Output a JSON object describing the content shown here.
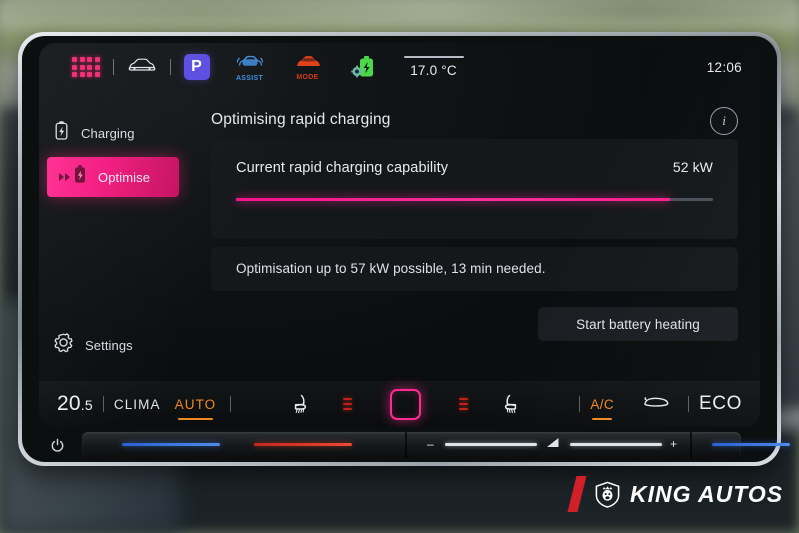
{
  "statusbar": {
    "apps_icon": "grid-apps-icon",
    "car_icon": "car-front-icon",
    "park_badge": "P",
    "assist_label": "ASSIST",
    "mode_label": "MODE",
    "battery_settings_icon": "battery-gear-icon",
    "temperature": "17.0 °C",
    "clock": "12:06"
  },
  "sidebar": {
    "items": [
      {
        "label": "Charging",
        "icon": "battery-charging-icon",
        "active": false
      },
      {
        "label": "Optimise",
        "icon": "battery-boost-icon",
        "active": true
      },
      {
        "label": "Settings",
        "icon": "gear-icon",
        "active": false
      }
    ]
  },
  "main": {
    "title": "Optimising rapid charging",
    "info_icon": "info-icon",
    "capability": {
      "label": "Current rapid charging capability",
      "value": "52 kW",
      "progress_percent": 91
    },
    "note": "Optimisation up to 57 kW possible, 13 min needed.",
    "action_button": "Start battery heating"
  },
  "climate": {
    "temperature": "20.5",
    "temperature_int": "20",
    "temperature_dec": ".5",
    "clima_label": "CLIMA",
    "auto_label": "AUTO",
    "left_seat_icon": "heated-seat-left-icon",
    "left_level_icon": "heat-level-indicator",
    "fan_icon": "climate-fan-button",
    "right_level_icon": "heat-level-indicator",
    "right_seat_icon": "heated-seat-right-icon",
    "ac_label": "A/C",
    "defrost_icon": "windshield-defrost-icon",
    "eco_label": "ECO"
  },
  "touchbar": {
    "power_icon": "power-icon",
    "minus_glyph": "–",
    "plus_glyph": "+",
    "volume_icon": "volume-icon"
  },
  "watermark": {
    "text": "KING AUTOS",
    "logo_icon": "king-autos-shield-icon"
  },
  "colors": {
    "accent_pink": "#ff2a8f",
    "accent_orange": "#f08a1e",
    "park_purple": "#5b4de0",
    "assist_blue": "#3f8fe0",
    "mode_red": "#d13a12",
    "screen_bg": "#0b0e10",
    "card_bg": "#15181b"
  }
}
